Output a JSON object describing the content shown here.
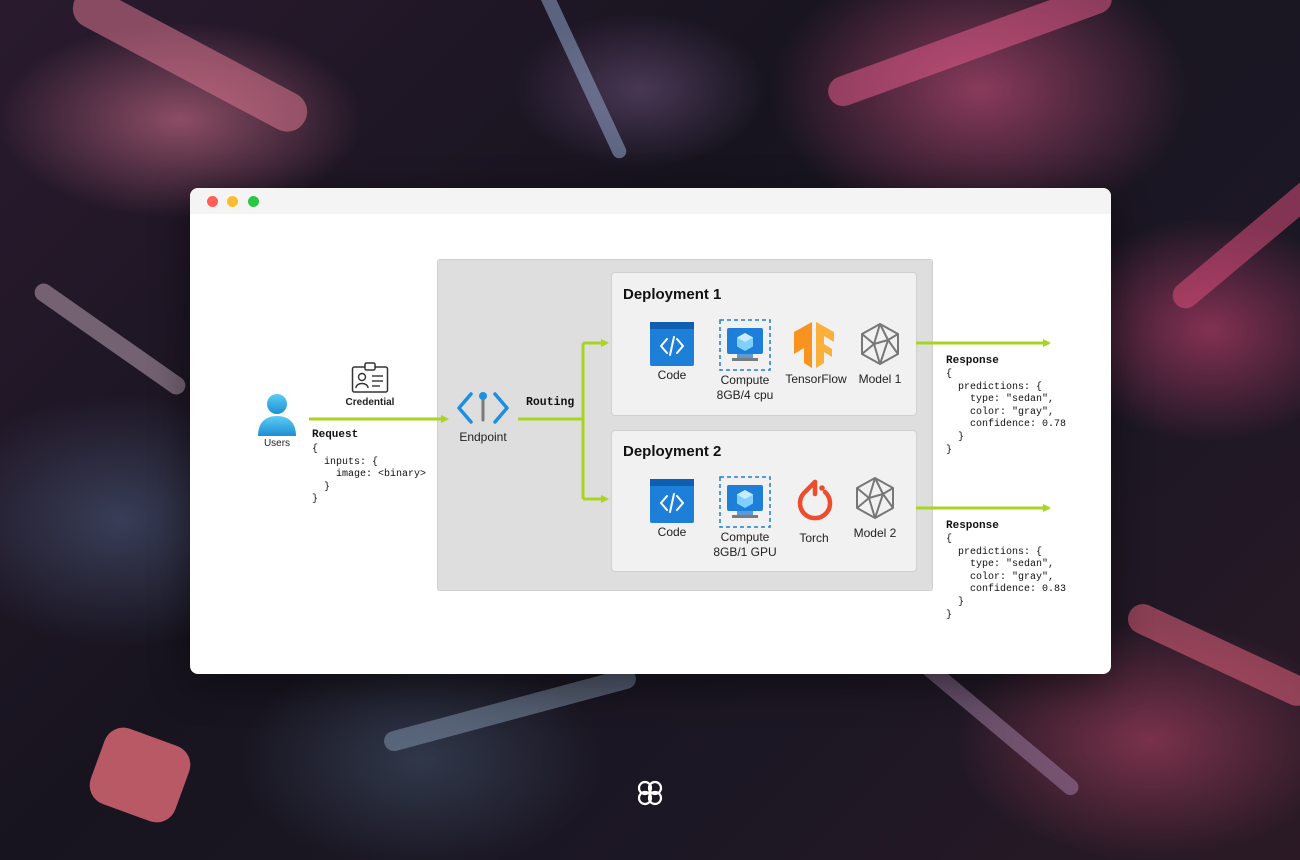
{
  "colors": {
    "arrow": "#a8d51f",
    "azure_blue": "#1e7fd8",
    "tensorflow": "#f7931e",
    "torch": "#ee4c2c",
    "window_bg": "#ffffff"
  },
  "window": {
    "traffic_lights": [
      "#ff5f57",
      "#febc2e",
      "#28c840"
    ]
  },
  "users": {
    "label": "Users",
    "icon": "user-icon"
  },
  "credential": {
    "label": "Credential",
    "icon": "id-card-icon"
  },
  "request": {
    "title": "Request",
    "body_lines": [
      "{",
      "  inputs: {",
      "    image: <binary>",
      "  }",
      "}"
    ]
  },
  "endpoint": {
    "label": "Endpoint",
    "icon": "endpoint-icon"
  },
  "routing": {
    "label": "Routing"
  },
  "deployments": [
    {
      "title": "Deployment 1",
      "code_label": "Code",
      "compute_label": "Compute",
      "compute_spec": "8GB/4 cpu",
      "framework_label": "TensorFlow",
      "framework_icon": "tensorflow-icon",
      "model_label": "Model 1"
    },
    {
      "title": "Deployment 2",
      "code_label": "Code",
      "compute_label": "Compute",
      "compute_spec": "8GB/1 GPU",
      "framework_label": "Torch",
      "framework_icon": "pytorch-icon",
      "model_label": "Model 2"
    }
  ],
  "responses": [
    {
      "title": "Response",
      "body_lines": [
        "{",
        "  predictions: {",
        "    type: \"sedan\",",
        "    color: \"gray\",",
        "    confidence: 0.78",
        "  }",
        "}"
      ]
    },
    {
      "title": "Response",
      "body_lines": [
        "{",
        "  predictions: {",
        "    type: \"sedan\",",
        "    color: \"gray\",",
        "    confidence: 0.83",
        "  }",
        "}"
      ]
    }
  ],
  "footer_logo": {
    "icon": "brand-logo-icon"
  }
}
